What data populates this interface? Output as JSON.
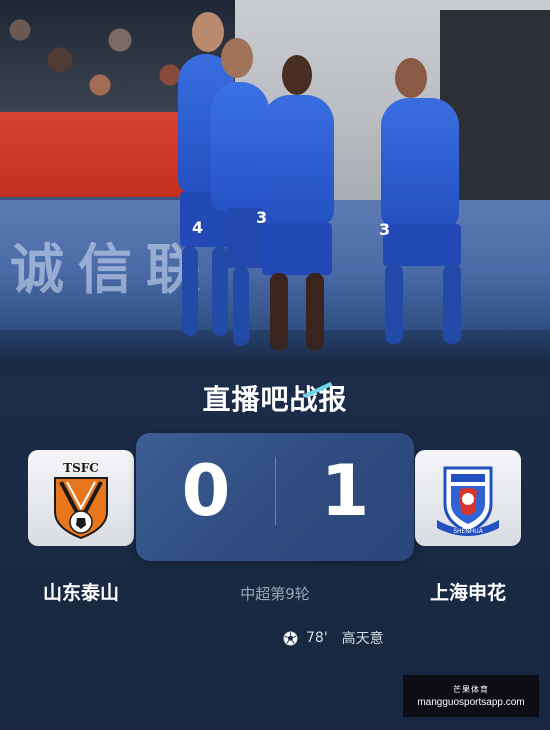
{
  "photo": {
    "ad_text": "诚信联",
    "jersey_numbers": [
      "4",
      "3",
      "3"
    ]
  },
  "header": {
    "title": "直播吧战报"
  },
  "match": {
    "home": {
      "name": "山东泰山",
      "short": "TSFC",
      "score": "0"
    },
    "away": {
      "name": "上海申花",
      "short": "SHENHUA",
      "score": "1"
    },
    "round": "中超第9轮",
    "events": [
      {
        "icon": "soccer-ball-icon",
        "minute": "78'",
        "player": "高天意"
      }
    ]
  },
  "watermark": {
    "label": "芒果体育",
    "url": "mangguosportsapp.com"
  },
  "colors": {
    "background": "#18273f",
    "score_panel": "#34558a",
    "shenhua_blue": "#2350c0",
    "taishan_orange": "#e8761c"
  }
}
